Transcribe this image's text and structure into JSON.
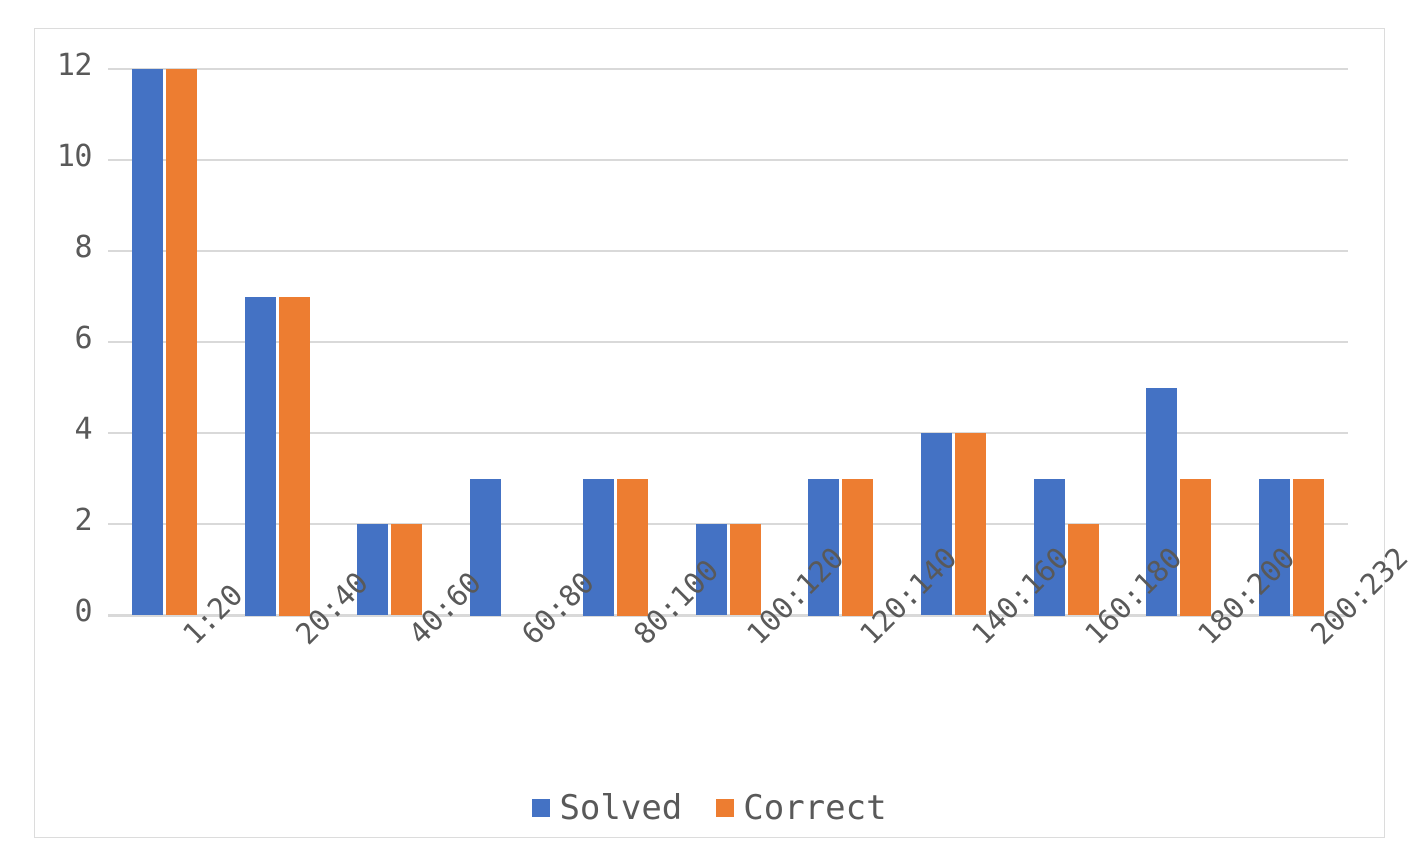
{
  "chart_data": {
    "type": "bar",
    "title": "",
    "subtitle": "",
    "xlabel": "",
    "ylabel": "",
    "categories": [
      "1:20",
      "20:40",
      "40:60",
      "60:80",
      "80:100",
      "100:120",
      "120:140",
      "140:160",
      "160:180",
      "180:200",
      "200:232"
    ],
    "series": [
      {
        "name": "Solved",
        "color": "#4472C4",
        "values": [
          12,
          7,
          2,
          3,
          3,
          2,
          3,
          4,
          3,
          5,
          3
        ]
      },
      {
        "name": "Correct",
        "color": "#ED7D31",
        "values": [
          12,
          7,
          2,
          0,
          3,
          2,
          3,
          4,
          2,
          3,
          3
        ]
      }
    ],
    "ylim": [
      0,
      12
    ],
    "yticks": [
      0,
      2,
      4,
      6,
      8,
      10,
      12
    ],
    "ytick_labels": [
      "0",
      "2",
      "4",
      "6",
      "8",
      "10",
      "12"
    ],
    "grid": true,
    "grid_axis": "y",
    "legend": {
      "position": "bottom-center",
      "entries": [
        {
          "label": "Solved",
          "color": "#4472C4"
        },
        {
          "label": "Correct",
          "color": "#ED7D31"
        }
      ]
    },
    "xtick_rotation": -45,
    "colors": {
      "grid": "#D9D9D9",
      "axis_text": "#595959",
      "frame_border": "#DCDCDC",
      "background": "#FFFFFF"
    }
  }
}
